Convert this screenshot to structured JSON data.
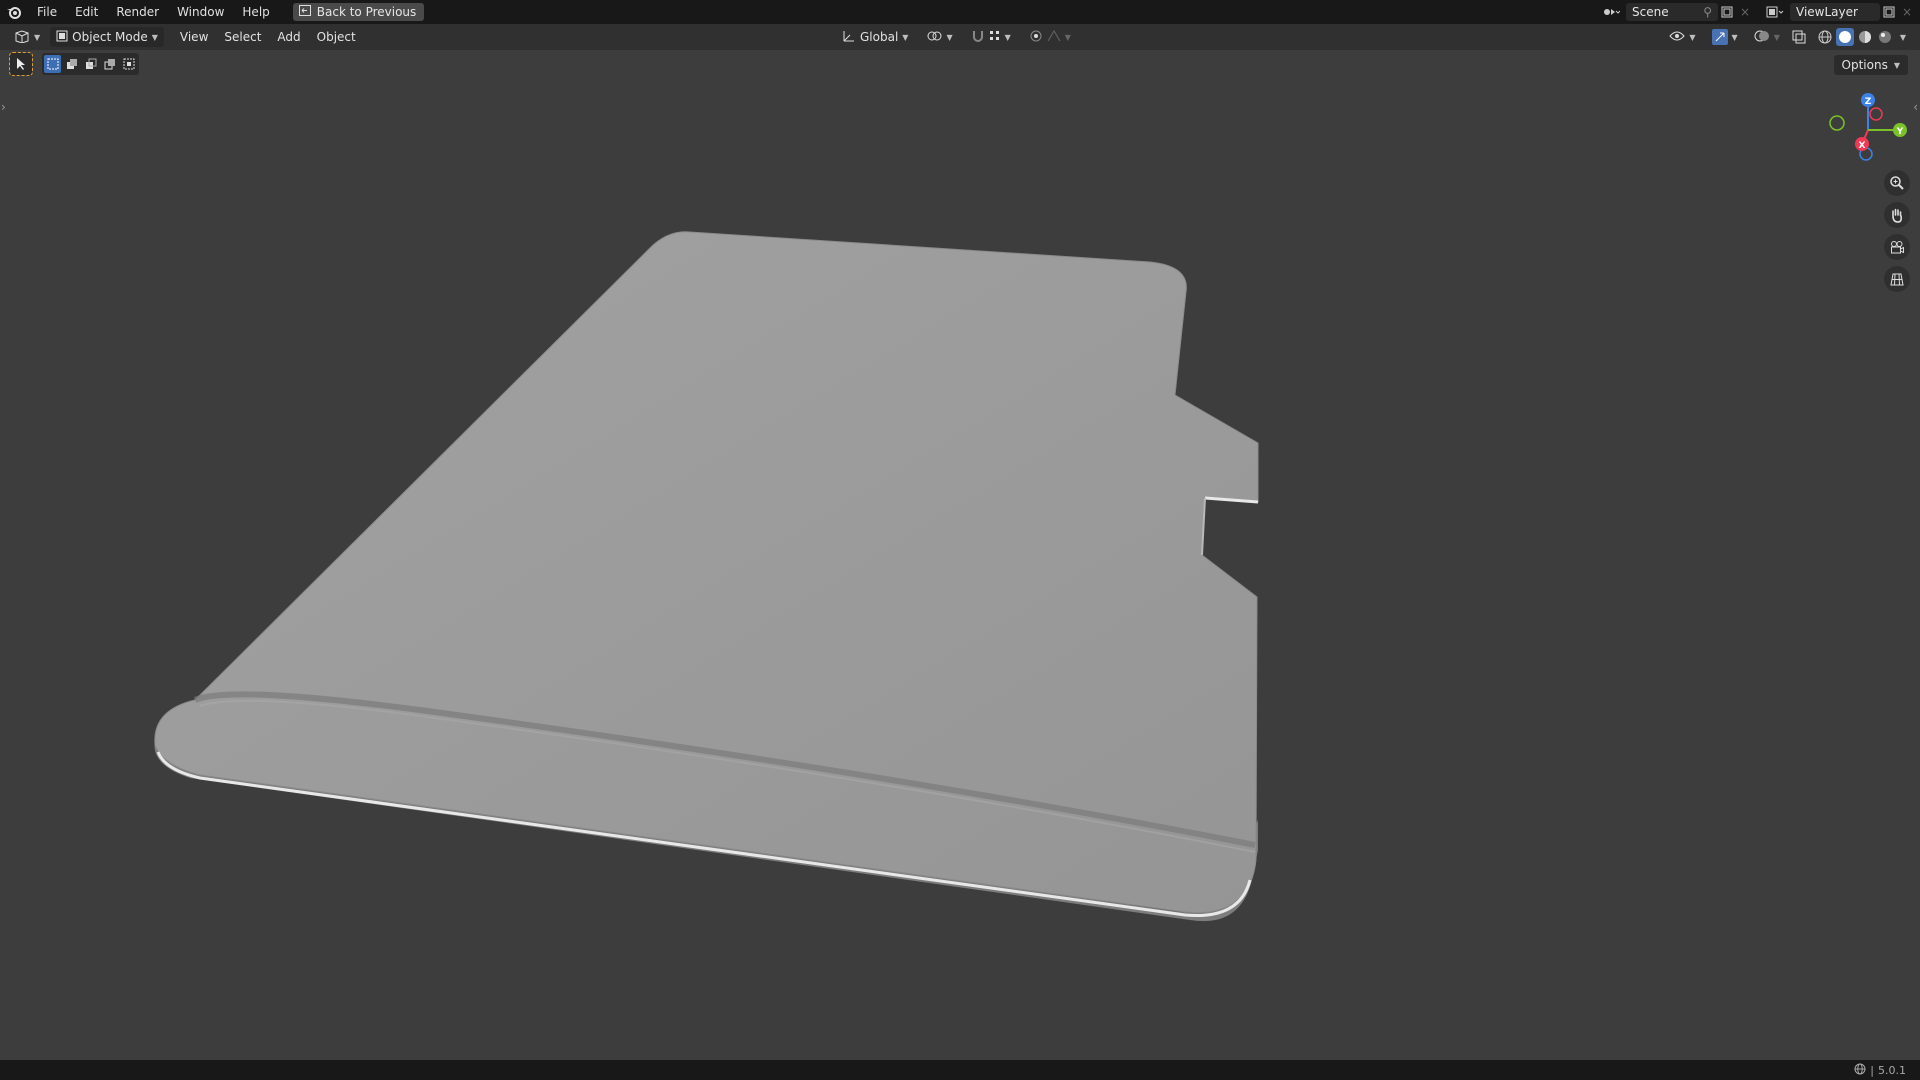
{
  "menu": {
    "items": [
      {
        "label": "File"
      },
      {
        "label": "Edit"
      },
      {
        "label": "Render"
      },
      {
        "label": "Window"
      },
      {
        "label": "Help"
      }
    ],
    "back_button": "Back to Previous"
  },
  "top_right": {
    "scene": "Scene",
    "view_layer": "ViewLayer"
  },
  "header": {
    "mode": "Object Mode",
    "menus": [
      {
        "label": "View"
      },
      {
        "label": "Select"
      },
      {
        "label": "Add"
      },
      {
        "label": "Object"
      }
    ],
    "orientation": "Global"
  },
  "viewport": {
    "options_label": "Options",
    "gizmo": {
      "x": "X",
      "y": "Y",
      "z": "Z"
    },
    "object_color": "#9a9a9a",
    "background_color": "#3d3d3d"
  },
  "statusbar": {
    "version": "5.0.1"
  },
  "colors": {
    "accent": "#4772b3",
    "axis_x": "#f03a53",
    "axis_y": "#7bc22a",
    "axis_z": "#3c82e8"
  }
}
